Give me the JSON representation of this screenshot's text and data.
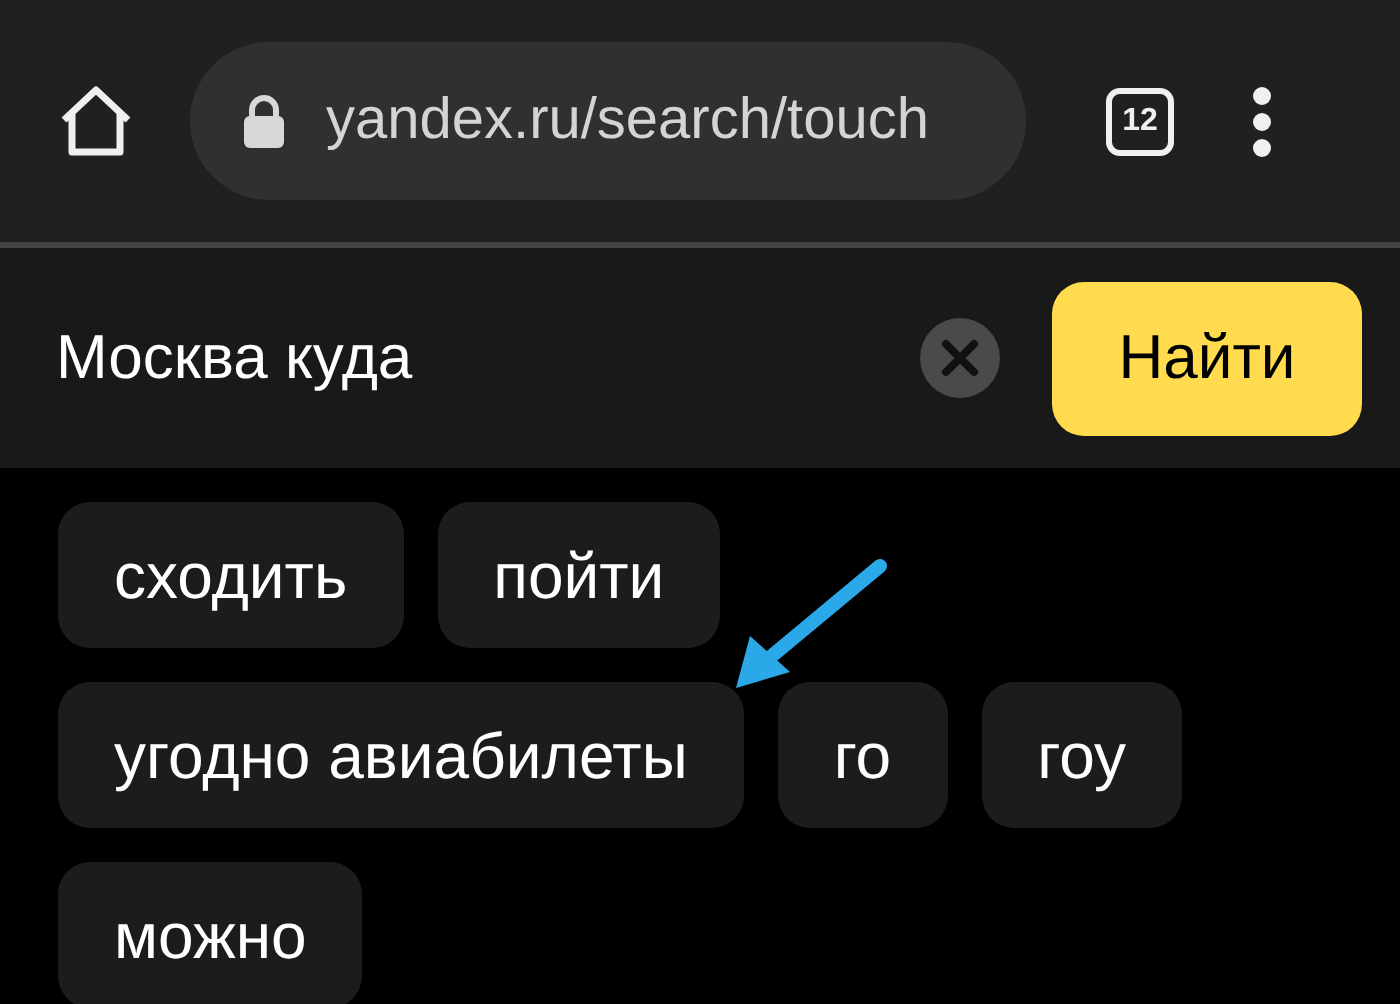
{
  "browser": {
    "url": "yandex.ru/search/touch",
    "tab_count": "12"
  },
  "search": {
    "value": "Москва куда",
    "button": "Найти"
  },
  "suggestions": [
    {
      "label": "сходить"
    },
    {
      "label": "пойти"
    },
    {
      "label": "угодно авиабилеты"
    },
    {
      "label": "го"
    },
    {
      "label": "гоу"
    },
    {
      "label": "можно"
    }
  ]
}
